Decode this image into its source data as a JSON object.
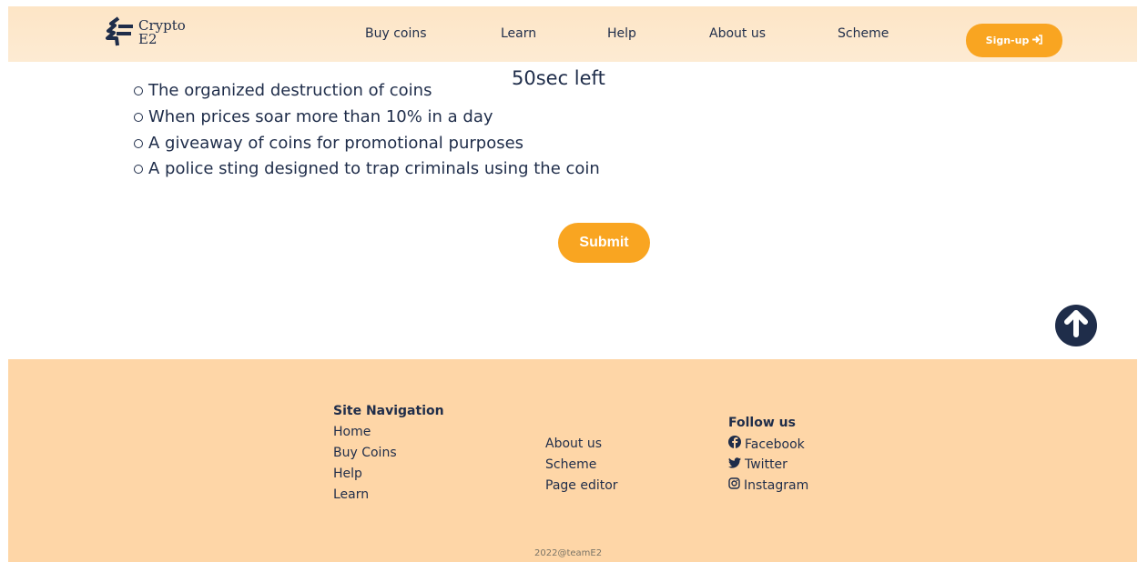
{
  "brand": {
    "line1": "Crypto",
    "line2": "E2"
  },
  "nav": {
    "items": [
      "Buy coins",
      "Learn",
      "Help",
      "About us",
      "Scheme"
    ],
    "signup_label": "Sign-up"
  },
  "quiz": {
    "timer": "50sec left",
    "options": [
      "The organized destruction of coins",
      "When prices soar more than 10% in a day",
      "A giveaway of coins for promotional purposes",
      "A police sting designed to trap criminals using the coin"
    ],
    "submit_label": "Submit"
  },
  "footer": {
    "site_nav_heading": "Site Navigation",
    "site_nav_links": [
      "Home",
      "Buy Coins",
      "Help",
      "Learn"
    ],
    "more_links": [
      "About us",
      "Scheme",
      "Page editor"
    ],
    "follow_heading": "Follow us",
    "social": [
      "Facebook",
      "Twitter",
      "Instagram"
    ],
    "copyright": "2022@teamE2"
  },
  "colors": {
    "accent": "#f9a521",
    "navy": "#1f2d4a",
    "header_bg": "#fde5c6",
    "footer_bg": "#fed6a7"
  },
  "icons": [
    "logo-icon",
    "sign-in-icon",
    "arrow-up-icon",
    "facebook-icon",
    "twitter-icon",
    "instagram-icon"
  ]
}
